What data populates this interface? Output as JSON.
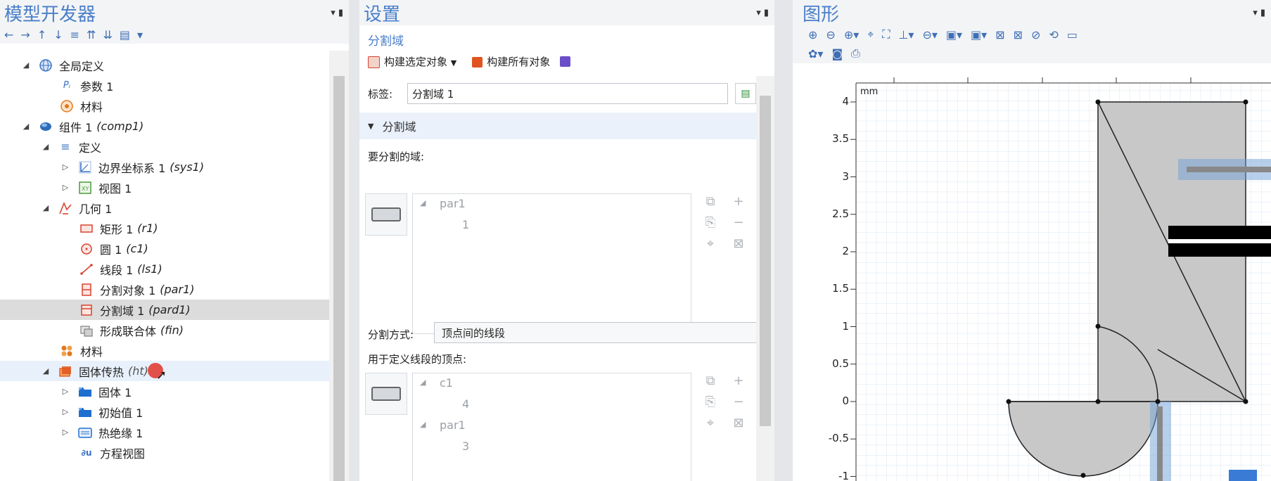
{
  "tree_panel": {
    "title": "模型开发器",
    "controls": "▾ ▮",
    "toolbar": [
      "←",
      "→",
      "↑",
      "↓",
      "≡",
      "⇈",
      "⇊",
      "▤",
      "▾"
    ],
    "nodes": [
      {
        "label": "全局定义",
        "tag": "",
        "icon": "globe-icon",
        "color": "#3a73c4"
      },
      {
        "label": "参数 1",
        "tag": "",
        "icon": "parameter-icon",
        "color": "#3a73c4"
      },
      {
        "label": "材料",
        "tag": "",
        "icon": "materials-icon",
        "color": "#e07a1f"
      },
      {
        "label": "组件 1",
        "tag": "(comp1)",
        "icon": "component-icon",
        "color": "#2f6cb8"
      },
      {
        "label": "定义",
        "tag": "",
        "icon": "definitions-icon",
        "color": "#3a73c4"
      },
      {
        "label": "边界坐标系 1",
        "tag": "(sys1)",
        "icon": "coordinate-system-icon",
        "color": "#3a73c4"
      },
      {
        "label": "视图 1",
        "tag": "",
        "icon": "view-icon",
        "color": "#4a9a3e"
      },
      {
        "label": "几何 1",
        "tag": "",
        "icon": "geometry-icon",
        "color": "#d8432f"
      },
      {
        "label": "矩形 1",
        "tag": "(r1)",
        "icon": "rectangle-icon",
        "color": "#d8432f"
      },
      {
        "label": "圆 1",
        "tag": "(c1)",
        "icon": "circle-icon",
        "color": "#d8432f"
      },
      {
        "label": "线段 1",
        "tag": "(ls1)",
        "icon": "line-segment-icon",
        "color": "#d8432f"
      },
      {
        "label": "分割对象 1",
        "tag": "(par1)",
        "icon": "partition-objects-icon",
        "color": "#d8432f"
      },
      {
        "label": "分割域 1",
        "tag": "(pard1)",
        "icon": "partition-domains-icon",
        "color": "#d8432f"
      },
      {
        "label": "形成联合体",
        "tag": "(fin)",
        "icon": "form-union-icon",
        "color": "#888888"
      },
      {
        "label": "材料",
        "tag": "",
        "icon": "materials-icon",
        "color": "#e07a1f"
      },
      {
        "label": "固体传热",
        "tag": "(ht)",
        "icon": "heat-transfer-icon",
        "color": "#e0541f"
      },
      {
        "label": "固体 1",
        "tag": "",
        "icon": "solid-icon",
        "color": "#1f6fd0"
      },
      {
        "label": "初始值 1",
        "tag": "",
        "icon": "initial-values-icon",
        "color": "#1f6fd0"
      },
      {
        "label": "热绝缘 1",
        "tag": "",
        "icon": "thermal-insulation-icon",
        "color": "#1f6fd0"
      },
      {
        "label": "方程视图",
        "tag": "",
        "icon": "equation-view-icon",
        "color": "#3a73c4"
      }
    ]
  },
  "settings_panel": {
    "title": "设置",
    "controls": "▾ ▮",
    "subtitle": "分割域",
    "build_selected": "构建选定对象",
    "build_all": "构建所有对象",
    "label_caption": "标签:",
    "label_value": "分割域 1",
    "section_title": "分割域",
    "domains_caption": "要分割的域:",
    "domains_list": [
      {
        "text": "par1",
        "level": 0
      },
      {
        "text": "1",
        "level": 1
      }
    ],
    "method_caption": "分割方式:",
    "method_value": "顶点间的线段",
    "vertices_caption": "用于定义线段的顶点:",
    "vertices_list": [
      {
        "text": "c1",
        "level": 0
      },
      {
        "text": "4",
        "level": 1
      },
      {
        "text": "par1",
        "level": 0
      },
      {
        "text": "3",
        "level": 1
      }
    ]
  },
  "graphics_panel": {
    "title": "图形",
    "controls": "▾ ▮",
    "unit": "mm",
    "y_ticks": [
      "4",
      "3.5",
      "3",
      "2.5",
      "2",
      "1.5",
      "1",
      "0.5",
      "0",
      "-0.5",
      "-1"
    ]
  },
  "colors": {
    "accent": "#4a7fc9",
    "selection": "#dcdcdc",
    "geometry_fill": "#c8c8c8",
    "grid": "#cfe2f2",
    "cursor_marker": "#e0342a"
  }
}
